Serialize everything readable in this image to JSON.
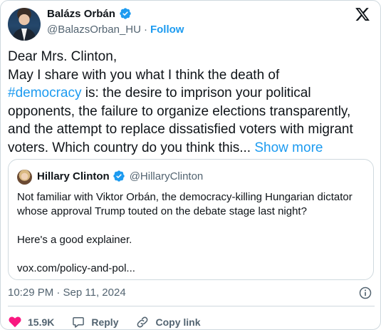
{
  "author": {
    "name": "Balázs Orbán",
    "handle": "@BalazsOrban_HU",
    "separator": "·",
    "follow_label": "Follow"
  },
  "tweet": {
    "text_before_hashtag": "Dear Mrs. Clinton,\nMay I share with you what I think the death of\n",
    "hashtag": "#democracy",
    "text_after_hashtag": " is: the desire to imprison your political opponents, the failure to organize elections transparently, and the attempt to replace dissatisfied voters with migrant voters. Which country do you think this... ",
    "show_more_label": "Show more"
  },
  "quoted": {
    "name": "Hillary Clinton",
    "handle": "@HillaryClinton",
    "text": "Not familiar with Viktor Orbán, the democracy-killing Hungarian dictator whose approval Trump touted on the debate stage last night?\n\nHere's a good explainer.\n\nvox.com/policy-and-pol..."
  },
  "meta": {
    "timestamp": "10:29 PM · Sep 11, 2024"
  },
  "actions": {
    "like_count": "15.9K",
    "reply_label": "Reply",
    "copy_link_label": "Copy link"
  },
  "colors": {
    "accent": "#1d9bf0",
    "like": "#f91880",
    "text": "#0f1419",
    "secondary": "#536471",
    "border": "#cfd9de"
  },
  "icons": [
    "verified-badge-icon",
    "x-logo-icon",
    "info-icon",
    "heart-icon",
    "reply-icon",
    "link-icon"
  ]
}
